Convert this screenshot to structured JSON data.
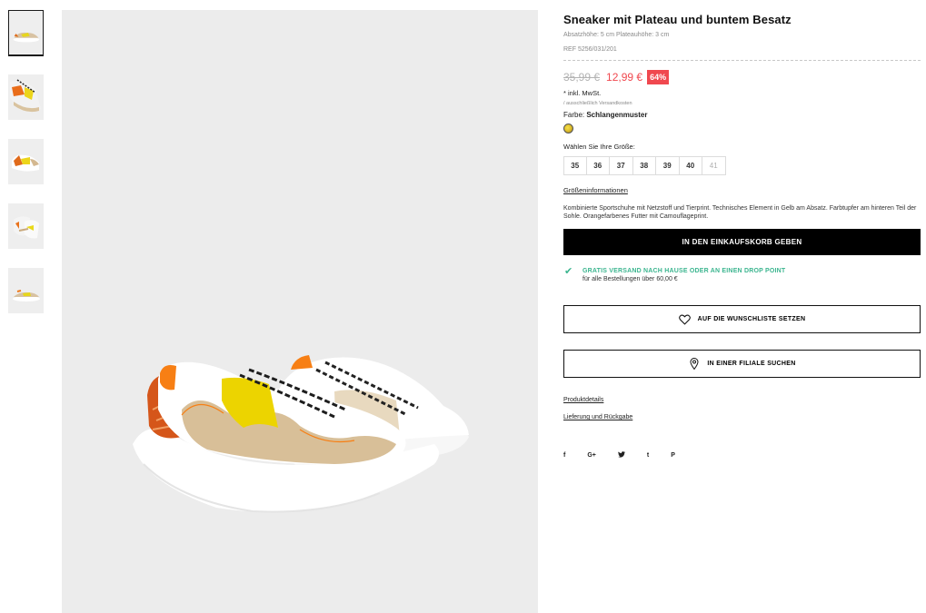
{
  "thumbnails": [
    {
      "alt": "sneaker-side"
    },
    {
      "alt": "sneaker-top"
    },
    {
      "alt": "sneaker-back"
    },
    {
      "alt": "sneaker-pair"
    },
    {
      "alt": "sneaker-profile"
    }
  ],
  "product": {
    "title": "Sneaker mit Plateau und buntem Besatz",
    "subtitle": "Absatzhöhe: 5 cm Plateauhöhe: 3 cm",
    "ref": "REF 5256/031/201",
    "old_price": "35,99 €",
    "new_price": "12,99 €",
    "discount": "64%",
    "tax": "* inkl. MwSt.",
    "shipping_note": "/ ausschließlich Versandkosten",
    "color_prefix": "Farbe: ",
    "color_name": "Schlangenmuster",
    "size_label": "Wählen Sie Ihre Größe:",
    "sizes": [
      "35",
      "36",
      "37",
      "38",
      "39",
      "40",
      "41"
    ],
    "size_info": "Größeninformationen",
    "description": "Kombinierte Sportschuhe mit Netzstoff und Tierprint. Technisches Element in Gelb am Absatz. Farbtupfer am hinteren Teil der Sohle. Orangefarbenes Futter mit Camouflageprint."
  },
  "cart_button": "IN DEN EINKAUFSKORB GEBEN",
  "shipping": {
    "title": "GRATIS VERSAND NACH HAUSE ODER AN EINEN DROP POINT",
    "sub": "für alle Bestellungen über 60,00 €"
  },
  "wishlist_button": "AUF DIE WUNSCHLISTE SETZEN",
  "store_button": "IN EINER FILIALE SUCHEN",
  "links": {
    "details": "Produktdetails",
    "delivery": "Lieferung und Rückgabe"
  },
  "social": [
    "f",
    "G+",
    "🐦",
    "t",
    "P"
  ],
  "colors": {
    "sale": "#f0484f",
    "ship_green": "#3bb58f",
    "background_gray": "#ececec"
  }
}
